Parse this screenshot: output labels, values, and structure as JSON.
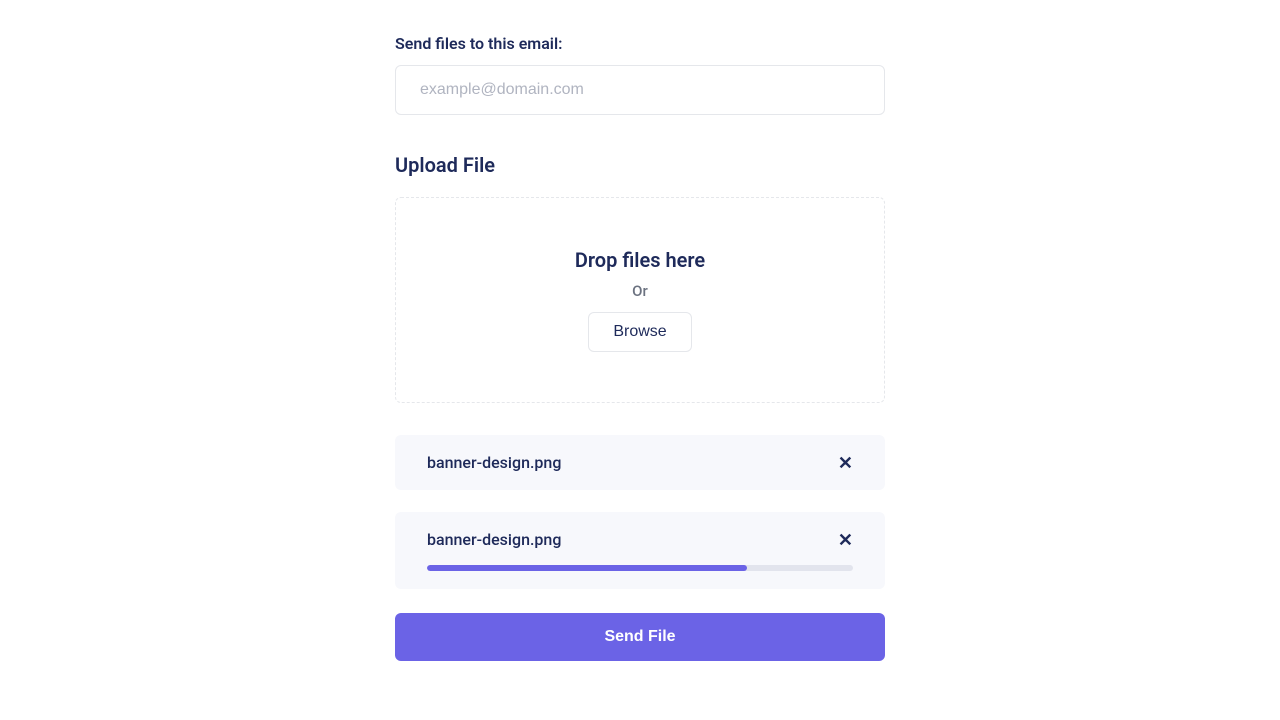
{
  "email": {
    "label": "Send files to this email:",
    "placeholder": "example@domain.com",
    "value": ""
  },
  "upload": {
    "section_title": "Upload File",
    "drop_title": "Drop files here",
    "or_text": "Or",
    "browse_label": "Browse"
  },
  "files": [
    {
      "name": "banner-design.png",
      "has_progress": false,
      "progress": 0
    },
    {
      "name": "banner-design.png",
      "has_progress": true,
      "progress": 75
    }
  ],
  "actions": {
    "send_label": "Send File"
  },
  "colors": {
    "accent": "#6b63e6",
    "text": "#1e2a5a",
    "panel": "#f7f8fc"
  }
}
